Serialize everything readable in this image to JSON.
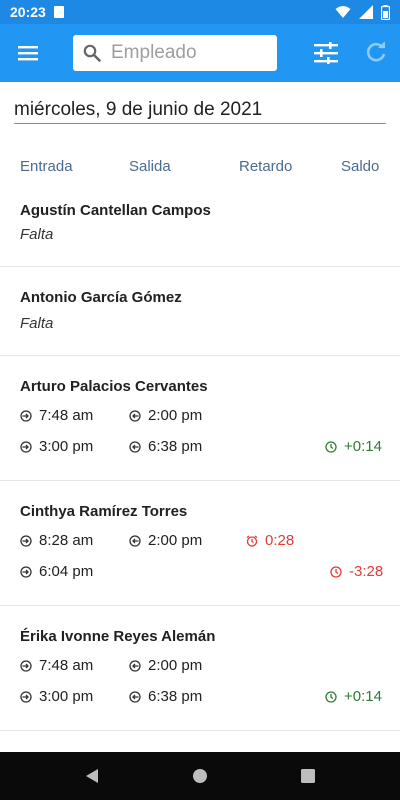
{
  "status_bar": {
    "time": "20:23"
  },
  "toolbar": {
    "search_placeholder": "Empleado"
  },
  "date": "miércoles, 9 de junio de 2021",
  "columns": {
    "entrada": "Entrada",
    "salida": "Salida",
    "retardo": "Retardo",
    "saldo": "Saldo"
  },
  "records": [
    {
      "name": "Agustín Cantellan Campos",
      "status": "Falta"
    },
    {
      "name": "Antonio García Gómez",
      "status": "Falta"
    },
    {
      "name": "Arturo Palacios Cervantes",
      "rows": [
        {
          "in": "7:48 am",
          "out": "2:00 pm"
        },
        {
          "in": "3:00 pm",
          "out": "6:38 pm",
          "balance": "+0:14"
        }
      ]
    },
    {
      "name": "Cinthya Ramírez Torres",
      "rows": [
        {
          "in": "8:28 am",
          "out": "2:00 pm",
          "delay": "0:28"
        },
        {
          "in": "6:04 pm",
          "balance": "-3:28"
        }
      ]
    },
    {
      "name": "Érika Ivonne Reyes Alemán",
      "rows": [
        {
          "in": "7:48 am",
          "out": "2:00 pm"
        },
        {
          "in": "3:00 pm",
          "out": "6:38 pm",
          "balance": "+0:14"
        }
      ]
    }
  ],
  "colors": {
    "app_bar": "#2196f3",
    "status_bar": "#1e88e5",
    "header_text": "#4a6b8f",
    "positive": "#2e7d32",
    "negative": "#e53935"
  }
}
